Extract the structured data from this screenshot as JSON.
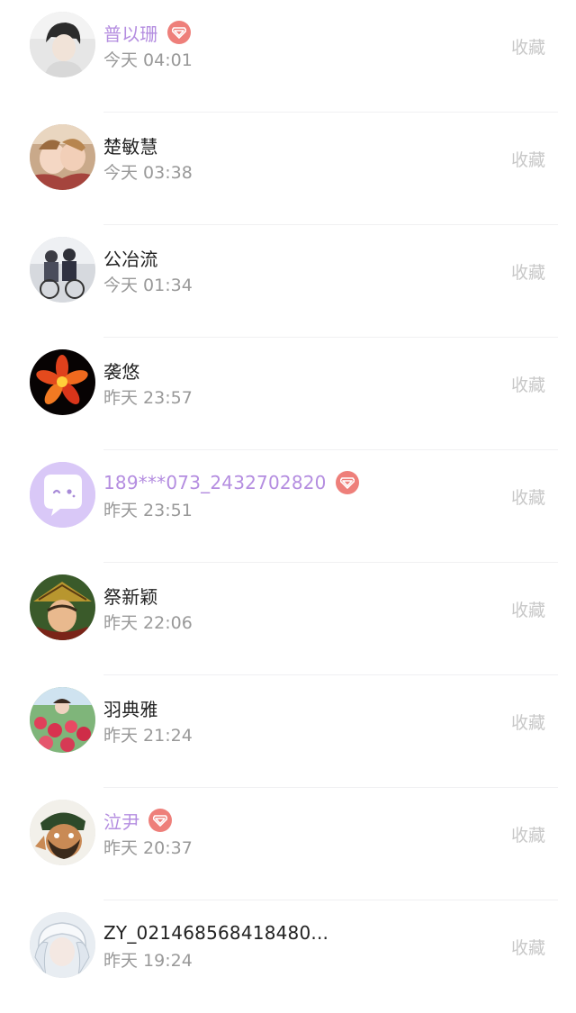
{
  "contacts": [
    {
      "name": "普以珊",
      "vip": true,
      "time": "今天 04:01",
      "action": "收藏",
      "avatar": "portrait-icon"
    },
    {
      "name": "楚敏慧",
      "vip": false,
      "time": "今天 03:38",
      "action": "收藏",
      "avatar": "portrait-icon"
    },
    {
      "name": "公冶流",
      "vip": false,
      "time": "今天 01:34",
      "action": "收藏",
      "avatar": "portrait-icon"
    },
    {
      "name": "袭悠",
      "vip": false,
      "time": "昨天 23:57",
      "action": "收藏",
      "avatar": "flower-icon"
    },
    {
      "name": "189***073_2432702820",
      "vip": true,
      "time": "昨天 23:51",
      "action": "收藏",
      "avatar": "chat-bubble-icon"
    },
    {
      "name": "祭新颖",
      "vip": false,
      "time": "昨天 22:06",
      "action": "收藏",
      "avatar": "portrait-icon"
    },
    {
      "name": "羽典雅",
      "vip": false,
      "time": "昨天 21:24",
      "action": "收藏",
      "avatar": "portrait-icon"
    },
    {
      "name": "泣尹",
      "vip": true,
      "time": "昨天 20:37",
      "action": "收藏",
      "avatar": "portrait-icon"
    },
    {
      "name": "ZY_021468568418480...",
      "vip": false,
      "time": "昨天 19:24",
      "action": "收藏",
      "avatar": "portrait-icon"
    }
  ],
  "colors": {
    "vip_name": "#b48de0",
    "vip_badge": "#ee7f7a",
    "default_avatar_bg": "#d9c8f7"
  }
}
